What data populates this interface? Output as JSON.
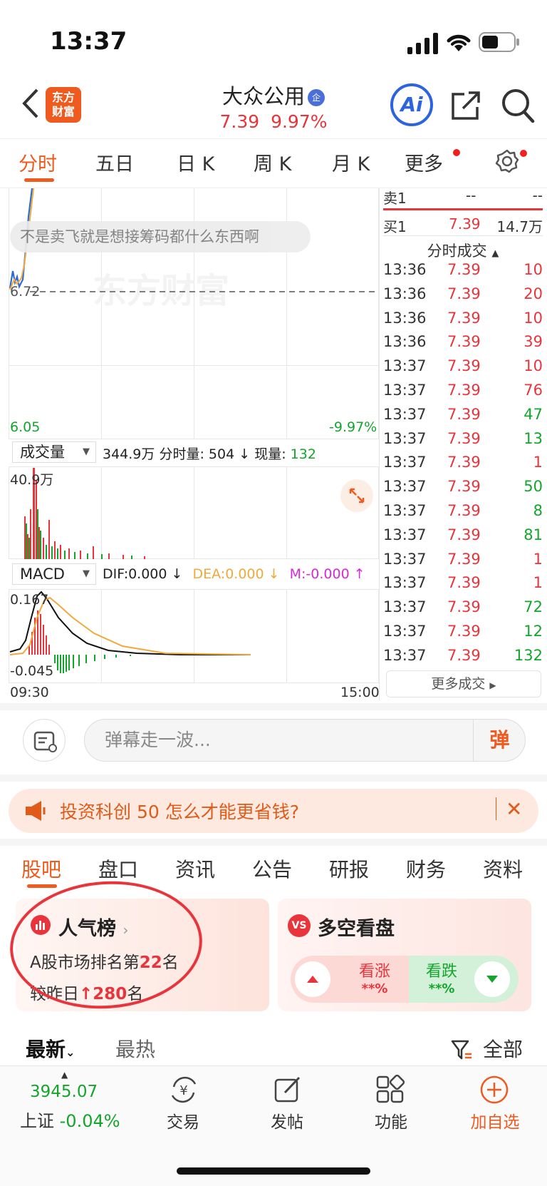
{
  "status": {
    "time": "13:37"
  },
  "header": {
    "logo_line1": "东方",
    "logo_line2": "财富",
    "title": "大众公用",
    "badge": "企",
    "price": "7.39",
    "change_pct": "9.97%",
    "ai_label": "Ai"
  },
  "time_tabs": [
    "分时",
    "五日",
    "日 K",
    "周 K",
    "月 K",
    "更多"
  ],
  "chart": {
    "bubble_text": "不是卖飞就是想接筹码都什么东西啊",
    "watermark": "东方财富",
    "prev_close": "6.72",
    "low_price": "6.05",
    "low_pct": "-9.97%",
    "volume_selector": "成交量",
    "volume_total": "344.9万",
    "minute_vol_label": "分时量: 504",
    "current_vol_label": "现量:",
    "current_vol_value": "132",
    "vol_max": "40.9万",
    "macd_selector": "MACD",
    "dif": "DIF:0.000",
    "dea": "DEA:0.000",
    "m": "M:-0.000",
    "macd_max": "0.167",
    "macd_min": "-0.045",
    "time_start": "09:30",
    "time_end": "15:00",
    "arrow_down": "↓",
    "arrow_up": "↑"
  },
  "order_book": {
    "sell1": {
      "label": "卖1",
      "price": "--",
      "vol": "--"
    },
    "buy1": {
      "label": "买1",
      "price": "7.39",
      "vol": "14.7万"
    }
  },
  "trades_header": "分时成交",
  "trades": [
    {
      "time": "13:36",
      "price": "7.39",
      "vol": "10",
      "dir": "up"
    },
    {
      "time": "13:36",
      "price": "7.39",
      "vol": "20",
      "dir": "up"
    },
    {
      "time": "13:36",
      "price": "7.39",
      "vol": "10",
      "dir": "up"
    },
    {
      "time": "13:36",
      "price": "7.39",
      "vol": "39",
      "dir": "up"
    },
    {
      "time": "13:37",
      "price": "7.39",
      "vol": "10",
      "dir": "up"
    },
    {
      "time": "13:37",
      "price": "7.39",
      "vol": "76",
      "dir": "up"
    },
    {
      "time": "13:37",
      "price": "7.39",
      "vol": "47",
      "dir": "down"
    },
    {
      "time": "13:37",
      "price": "7.39",
      "vol": "13",
      "dir": "down"
    },
    {
      "time": "13:37",
      "price": "7.39",
      "vol": "1",
      "dir": "up"
    },
    {
      "time": "13:37",
      "price": "7.39",
      "vol": "50",
      "dir": "down"
    },
    {
      "time": "13:37",
      "price": "7.39",
      "vol": "8",
      "dir": "down"
    },
    {
      "time": "13:37",
      "price": "7.39",
      "vol": "81",
      "dir": "down"
    },
    {
      "time": "13:37",
      "price": "7.39",
      "vol": "1",
      "dir": "up"
    },
    {
      "time": "13:37",
      "price": "7.39",
      "vol": "1",
      "dir": "up"
    },
    {
      "time": "13:37",
      "price": "7.39",
      "vol": "72",
      "dir": "down"
    },
    {
      "time": "13:37",
      "price": "7.39",
      "vol": "12",
      "dir": "down"
    },
    {
      "time": "13:37",
      "price": "7.39",
      "vol": "132",
      "dir": "down"
    }
  ],
  "more_trades": "更多成交",
  "danmu": {
    "placeholder": "弹幕走一波...",
    "button": "弹"
  },
  "ad": {
    "text": "投资科创 50 怎么才能更省钱?"
  },
  "content_tabs": [
    "股吧",
    "盘口",
    "资讯",
    "公告",
    "研报",
    "财务",
    "资料"
  ],
  "popularity": {
    "title": "人气榜",
    "line1_prefix": "A股市场排名第",
    "rank": "22",
    "line1_suffix": "名",
    "line2_prefix": "较昨日",
    "change": "280",
    "line2_suffix": "名"
  },
  "sentiment": {
    "title": "多空看盘",
    "bull_label": "看涨",
    "bull_value": "**%",
    "bear_label": "看跌",
    "bear_value": "**%"
  },
  "sort": {
    "latest": "最新",
    "hottest": "最热",
    "filter": "全部"
  },
  "bottom_bar": {
    "index_value": "3945.07",
    "index_name": "上证",
    "index_change": "-0.04%",
    "trade": "交易",
    "post": "发帖",
    "features": "功能",
    "add_watch": "加自选"
  },
  "colors": {
    "accent": "#ef5a1e",
    "up": "#e8343a",
    "down": "#14a52c",
    "ai": "#2c63e0"
  }
}
